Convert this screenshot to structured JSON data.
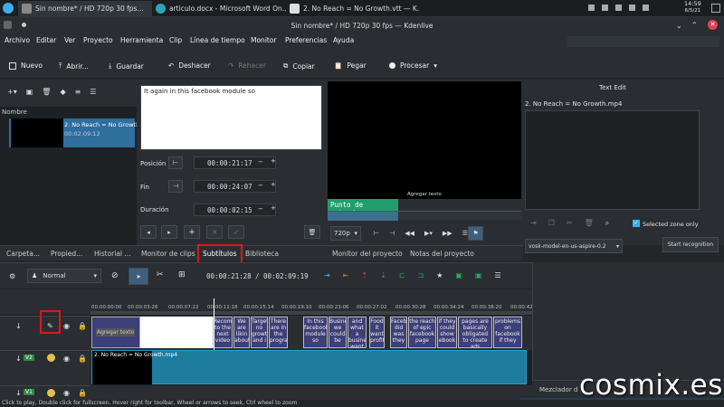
{
  "taskbar": {
    "tabs": [
      {
        "label": "Sin nombre* / HD 720p 30 fps..."
      },
      {
        "label": "articulo.docx - Microsoft Word On..."
      },
      {
        "label": "2. No Reach = No Growth.vtt — K..."
      }
    ],
    "clock_time": "14:59",
    "clock_date": "6/5/21"
  },
  "window": {
    "title": "Sin nombre* / HD 720p 30 fps — Kdenlive"
  },
  "menu": [
    "Archivo",
    "Editar",
    "Ver",
    "Proyecto",
    "Herramienta",
    "Clip",
    "Línea de tiempo",
    "Monitor",
    "Preferencias",
    "Ayuda"
  ],
  "toolbar": {
    "nuevo": "Nuevo",
    "abrir": "Abrir...",
    "guardar": "Guardar",
    "deshacer": "Deshacer",
    "rehacer": "Rehacer",
    "copiar": "Copiar",
    "pegar": "Pegar",
    "procesar": "Procesar"
  },
  "bin": {
    "column_header": "Nombre",
    "clip_name": "2. No Reach = No Growth",
    "clip_duration": "00:02:09:12"
  },
  "subtitle_editor": {
    "text": "It again in this facebook module so",
    "posicion_label": "Posición",
    "posicion_value": "00:00:21:17",
    "fin_label": "Fin",
    "fin_value": "00:00:24:07",
    "duracion_label": "Duración",
    "duracion_value": "00:00:02:15"
  },
  "monitor": {
    "overlay_text": "Agregar texto",
    "in_point": "Punto de entrada",
    "resolution": "720p"
  },
  "text_edit": {
    "title": "Text Edit",
    "file": "2. No Reach = No Growth.mp4",
    "selected_zone": "Selected zone only",
    "model": "vosk-model-en-us-aspire-0.2",
    "start_button": "Start recognition"
  },
  "tabs_left": [
    "Carpeta...",
    "Propied...",
    "Historial ...",
    "Monitor de clips",
    "Subtítulos",
    "Biblioteca"
  ],
  "tabs_right": [
    "Monitor del proyecto",
    "Notas del proyecto"
  ],
  "timeline": {
    "mode": "Normal",
    "position": "00:00:21:28",
    "separator": "/",
    "duration": "00:02:09:19",
    "ruler": [
      "00:00:00:00",
      "00:00:03:26",
      "00:00:07:22",
      "00:00:11:18",
      "00:00:15:14",
      "00:00:19:10",
      "00:00:23:06",
      "00:00:27:02",
      "00:00:30:28",
      "00:00:34:24",
      "00:00:38:20",
      "00:00:42"
    ],
    "subtitle_first": "Agregar texto",
    "subtitle_clips": [
      "Recom to the next video",
      "We are likin about",
      "Target, no growth and i",
      "There are in the program",
      "In this facebook module so",
      "Business we could be",
      "and what a business want",
      "Food it want profit",
      "Facebook did was they",
      "the reach of epic facebook page",
      "if they could show ebook",
      "pages are basically obligated to create ads",
      "problems on facebook if they"
    ],
    "video_track": "V2",
    "video_clip": "2. No Reach = No Growth.mp4",
    "audio_track": "V1"
  },
  "mixer": {
    "label": "Mezclador d"
  },
  "status_bar": "Click to play, Double click for fullscreen, Hover right for toolbar, Wheel or arrows to seek, Ctrl wheel to zoom",
  "watermark": "cosmix.es",
  "colors": {
    "accent": "#3daee9",
    "highlight": "#e0161d",
    "video_clip": "#1e7d9f",
    "subtitle_clip": "#3d3f78",
    "inpoint": "#1f9f6f"
  }
}
